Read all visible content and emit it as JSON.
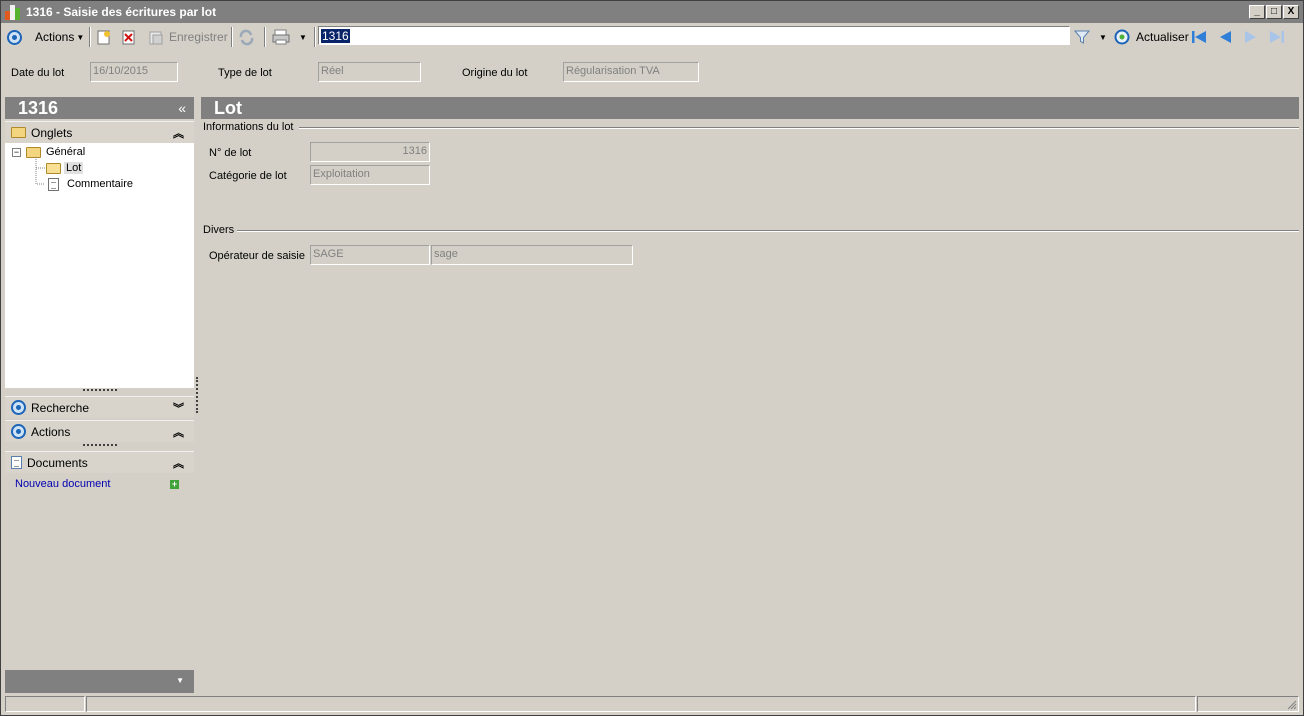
{
  "window": {
    "title": "1316 -  Saisie des écritures par lot",
    "min_label": "_",
    "max_label": "□",
    "close_label": "X"
  },
  "toolbar": {
    "actions_label": "Actions",
    "save_label": "Enregistrer",
    "search_value": "1316",
    "refresh_label": "Actualiser"
  },
  "header": {
    "date_label": "Date du lot",
    "date_value": "16/10/2015",
    "type_label": "Type de lot",
    "type_value": "Réel",
    "origin_label": "Origine du lot",
    "origin_value": "Régularisation TVA"
  },
  "left": {
    "title": "1316",
    "collapse": "«",
    "onglets_label": "Onglets",
    "tree": {
      "root": "Général",
      "items": [
        "Lot",
        "Commentaire"
      ]
    },
    "recherche_label": "Recherche",
    "actions_label": "Actions",
    "documents_label": "Documents",
    "new_document_label": "Nouveau document"
  },
  "content": {
    "title": "Lot",
    "info_group": "Informations du lot",
    "lot_number_label": "N° de lot",
    "lot_number_value": "1316",
    "category_label": "Catégorie de lot",
    "category_value": "Exploitation",
    "divers_group": "Divers",
    "operator_label": "Opérateur de saisie",
    "operator_code": "SAGE",
    "operator_name": "sage"
  },
  "colors": {
    "accent": "#1b64b8",
    "panel_header": "#808080",
    "background": "#d4d0c8"
  }
}
